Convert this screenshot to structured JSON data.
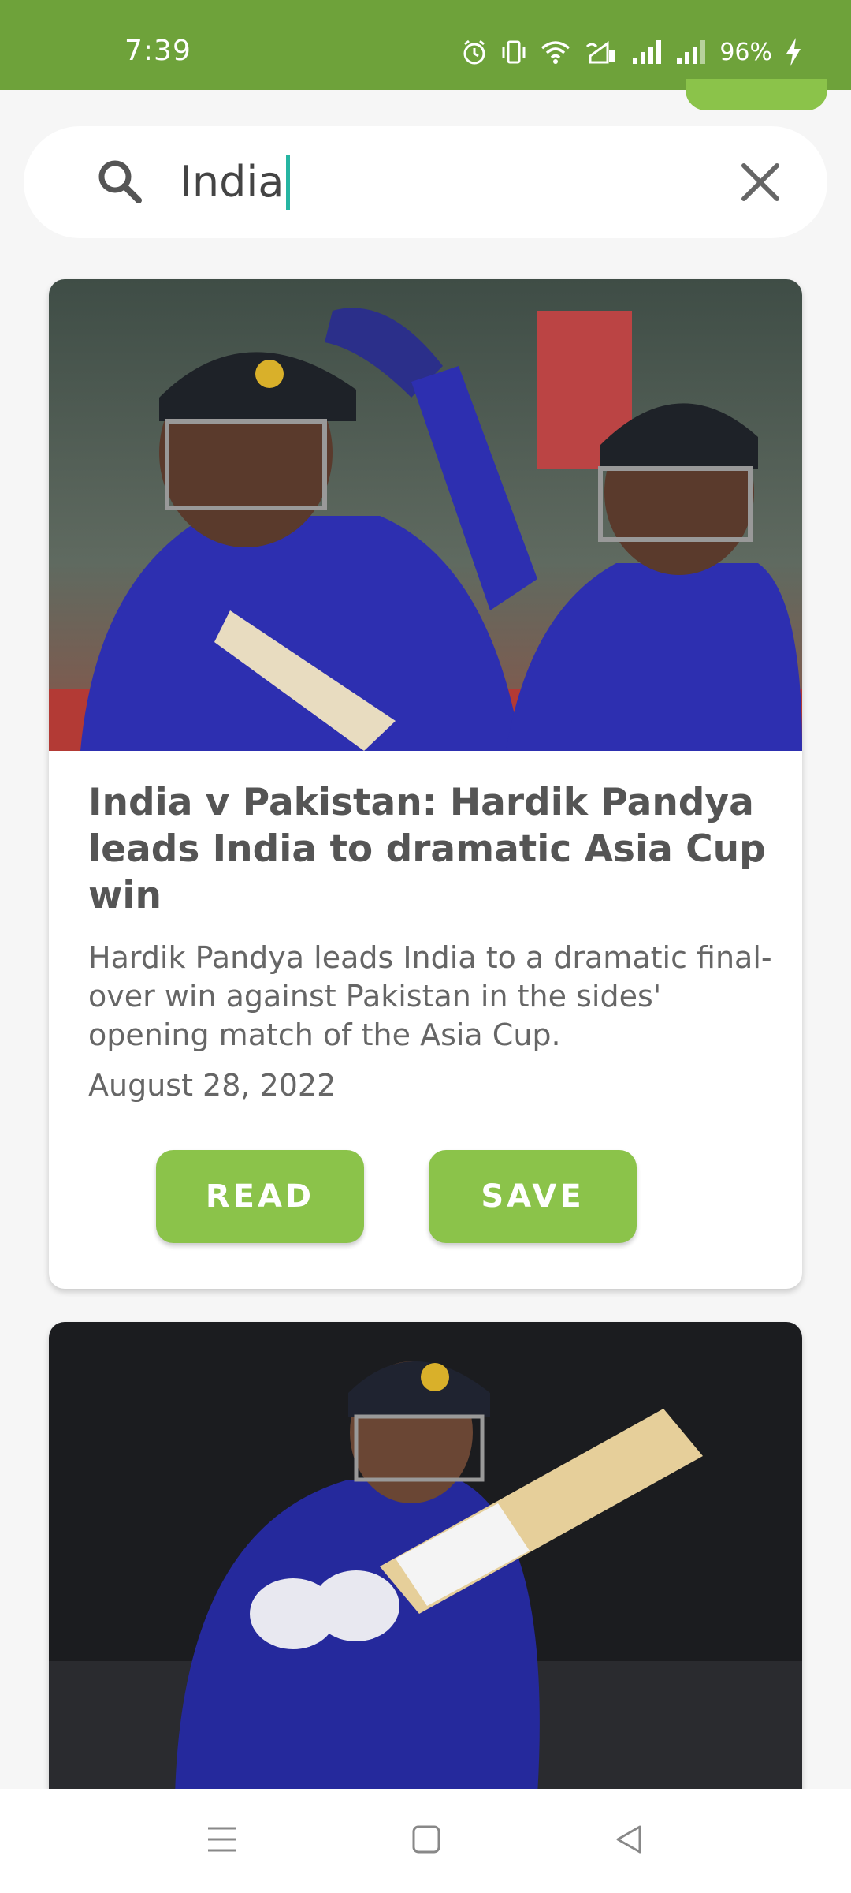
{
  "status_bar": {
    "time": "7:39",
    "battery": "96%",
    "icons": [
      "alarm-icon",
      "vibrate-icon",
      "wifi-icon",
      "volte-signal-icon",
      "signal-icon",
      "signal-icon-2",
      "charging-icon"
    ]
  },
  "search": {
    "query": "India",
    "icon": "search-icon",
    "clear_icon": "close-icon"
  },
  "articles": [
    {
      "image": "cricket-players-photo",
      "title": "India v Pakistan: Hardik Pandya leads India to dramatic Asia Cup win",
      "description": "Hardik Pandya leads India to a dramatic final-over win against Pakistan in the sides' opening match of the Asia Cup.",
      "date": "August 28, 2022",
      "read_label": "READ",
      "save_label": "SAVE"
    },
    {
      "image": "cricket-batter-photo"
    }
  ],
  "colors": {
    "status_bar": "#6ea23a",
    "accent": "#8bc34a",
    "caret": "#26b5a2",
    "background": "#f6f6f6"
  },
  "nav_bar": {
    "icons": [
      "menu-icon",
      "home-icon",
      "back-icon"
    ]
  }
}
